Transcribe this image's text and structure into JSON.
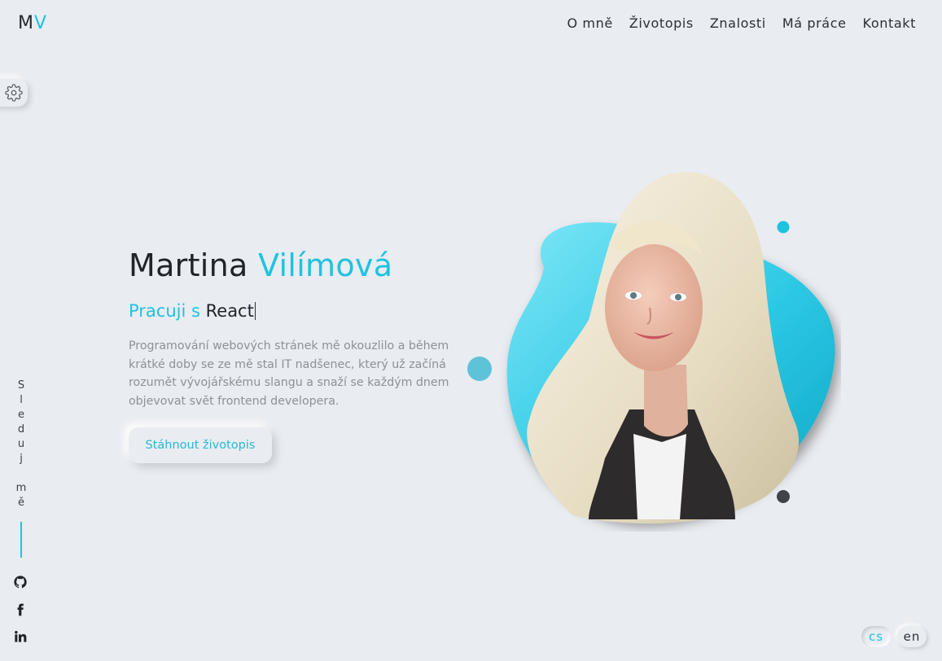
{
  "logo": {
    "first": "M",
    "second": "V"
  },
  "nav": {
    "about": "O mně",
    "cv": "Životopis",
    "skills": "Znalosti",
    "work": "Má práce",
    "contact": "Kontakt"
  },
  "settings_icon": "gear-icon",
  "follow": {
    "letters": [
      "S",
      "l",
      "e",
      "d",
      "u",
      "j"
    ],
    "letters2": [
      "m",
      "ě"
    ]
  },
  "social": {
    "icons": [
      "github-icon",
      "facebook-icon",
      "linkedin-icon"
    ]
  },
  "hero": {
    "first_name": "Martina",
    "last_name": "Vilímová",
    "typing_prefix": "Pracuji s",
    "typing_word": "React",
    "description": "Programování webových stránek mě okouzlilo a během krátké doby se ze mě stal IT nadšenec, který už začíná rozumět vývojářskému slangu a snaží se každým dnem objevovat svět frontend developera.",
    "cta_label": "Stáhnout životopis"
  },
  "language": {
    "cs": "cs",
    "en": "en",
    "active": "cs"
  },
  "colors": {
    "accent": "#1ec3e0",
    "background": "#e9ecf1",
    "text": "#1f232a",
    "muted": "#8d9198"
  }
}
